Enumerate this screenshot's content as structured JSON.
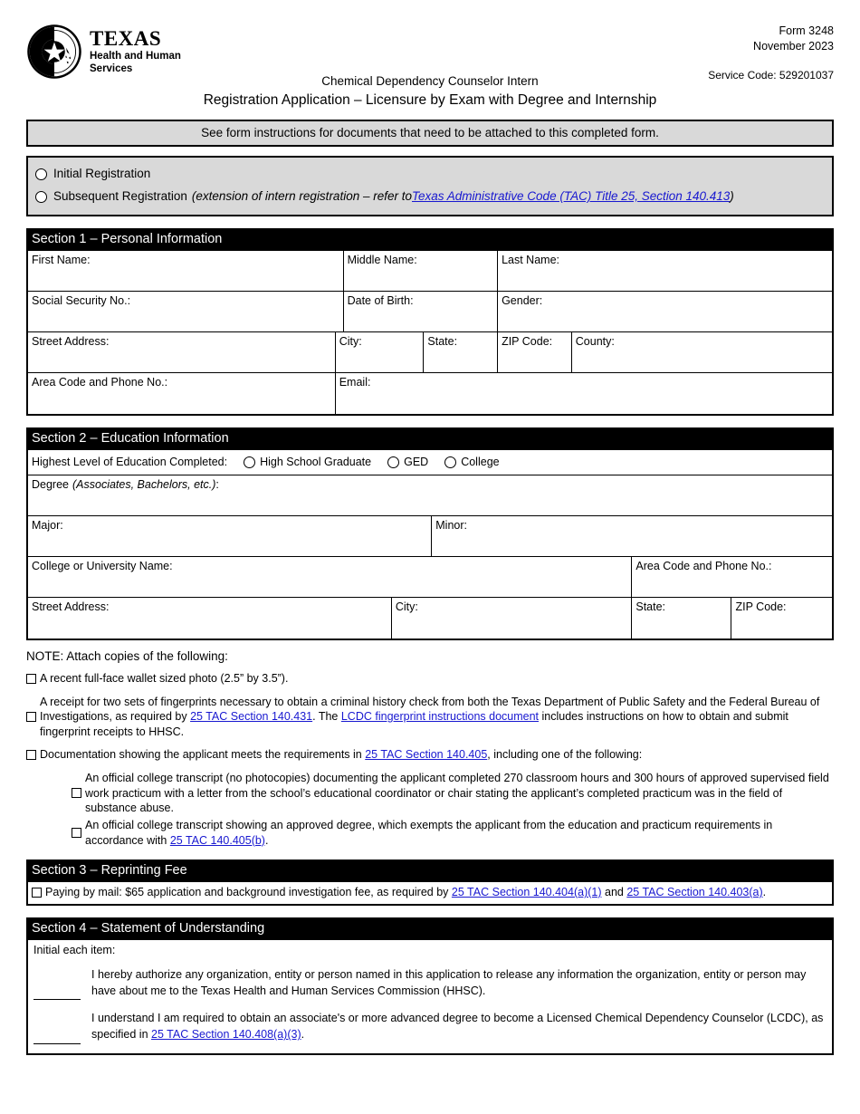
{
  "header": {
    "logo_texas": "TEXAS",
    "logo_line1": "Health and Human",
    "logo_line2": "Services",
    "form_number": "Form 3248",
    "form_date": "November 2023",
    "service_code": "Service Code: 529201037",
    "title_line1": "Chemical Dependency Counselor Intern",
    "title_line2": "Registration Application – Licensure by Exam with Degree and Internship"
  },
  "instruction_bar": "See form instructions for documents that need to be attached to this completed form.",
  "registration": {
    "initial_label": "Initial Registration",
    "subsequent_label": "Subsequent Registration",
    "subsequent_note_pre": "(extension of intern registration – refer to ",
    "subsequent_link": "Texas Administrative Code (TAC) Title 25, Section 140.413",
    "subsequent_note_post": ")"
  },
  "section1": {
    "heading": "Section 1 – Personal Information",
    "fields": {
      "first_name": "First Name:",
      "middle_name": "Middle Name:",
      "last_name": "Last Name:",
      "ssn": "Social Security No.:",
      "dob": "Date of Birth:",
      "gender": "Gender:",
      "street_address": "Street Address:",
      "city": "City:",
      "state": "State:",
      "zip": "ZIP Code:",
      "county": "County:",
      "phone": "Area Code and Phone No.:",
      "email": "Email:"
    }
  },
  "section2": {
    "heading": "Section 2 – Education Information",
    "highest_level_label": "Highest Level of Education Completed:",
    "level_options": [
      "High School Graduate",
      "GED",
      "College"
    ],
    "degree_label": "Degree",
    "degree_label_italic": "(Associates, Bachelors, etc.)",
    "degree_label_colon": ":",
    "fields": {
      "major": "Major:",
      "minor": "Minor:",
      "college_name": "College or University Name:",
      "college_phone": "Area Code and Phone No.:",
      "street_address": "Street Address:",
      "city": "City:",
      "state": "State:",
      "zip": "ZIP Code:"
    }
  },
  "note": {
    "title": "NOTE: Attach copies of the following:",
    "item1": "A recent full-face wallet sized photo (2.5” by 3.5”).",
    "item2_part1": "A receipt for two sets of fingerprints necessary to obtain a criminal history check from both the Texas Department of Public Safety and the Federal Bureau of Investigations, as required by ",
    "item2_link1": "25 TAC Section 140.431",
    "item2_part2": ". The ",
    "item2_link2": "LCDC fingerprint instructions document",
    "item2_part3": " includes instructions on how to obtain and submit fingerprint receipts to HHSC.",
    "item3_part1": "Documentation showing the applicant meets the requirements in ",
    "item3_link1": "25 TAC Section 140.405",
    "item3_part2": ", including one of the following:",
    "sub1": "An official college transcript (no photocopies) documenting the applicant completed 270 classroom hours and 300 hours of approved supervised field work practicum with a letter from the school’s educational coordinator or chair stating the applicant’s completed practicum was in the field of substance abuse.",
    "sub2_part1": "An official college transcript showing an approved degree, which exempts the applicant from the education and practicum requirements in accordance with ",
    "sub2_link": "25 TAC 140.405(b)",
    "sub2_part2": "."
  },
  "section3": {
    "heading": "Section 3 – Reprinting Fee",
    "fee_part1": "Paying by mail: $65 application and background investigation fee, as required by ",
    "fee_link1": "25 TAC Section 140.404(a)(1)",
    "fee_part2": " and ",
    "fee_link2": "25 TAC Section 140.403(a)",
    "fee_part3": "."
  },
  "section4": {
    "heading": "Section 4 –  Statement of Understanding",
    "intro": "Initial each item:",
    "item1": "I hereby authorize any organization, entity or person named in this application to release any information the organization, entity or person may have about me to the Texas Health and Human Services Commission (HHSC).",
    "item2_part1": "I understand I am required to obtain an associate's or more advanced degree to become a Licensed Chemical Dependency Counselor (LCDC), as specified in ",
    "item2_link": "25 TAC Section 140.408(a)(3)",
    "item2_part2": "."
  },
  "colors": {
    "link": "#1818d0",
    "section_header_bg": "#000000",
    "gray_bar_bg": "#d9d9d9"
  }
}
